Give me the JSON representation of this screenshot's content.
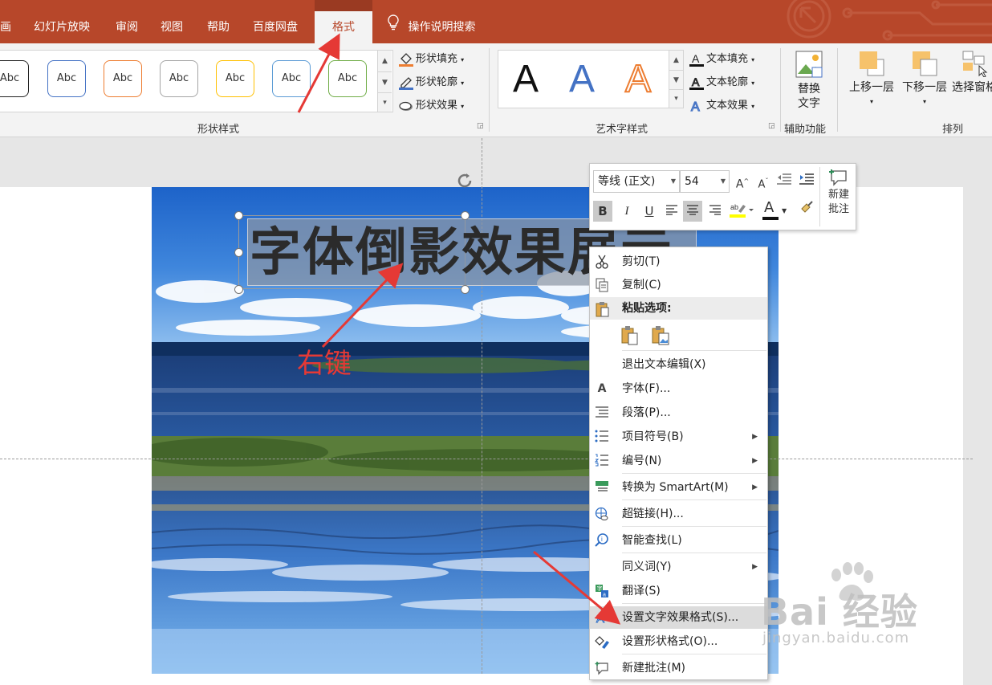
{
  "tabs": [
    {
      "label": "画"
    },
    {
      "label": "幻灯片放映"
    },
    {
      "label": "审阅"
    },
    {
      "label": "视图"
    },
    {
      "label": "帮助"
    },
    {
      "label": "百度网盘"
    },
    {
      "label": "格式",
      "active": true
    }
  ],
  "tell_me": "操作说明搜索",
  "ribbon": {
    "shape_styles": {
      "preview_label": "Abc",
      "swatch_colors": [
        "#222222",
        "#4472c4",
        "#ed7d31",
        "#a5a5a5",
        "#ffc000",
        "#5b9bd5",
        "#70ad47"
      ],
      "fill": "形状填充",
      "outline": "形状轮廓",
      "effect": "形状效果",
      "group_label": "形状样式"
    },
    "wordart": {
      "letter": "A",
      "text_fill": "文本填充",
      "text_outline": "文本轮廓",
      "text_effect": "文本效果",
      "group_label": "艺术字样式"
    },
    "accessibility": {
      "alt_text_line1": "替换",
      "alt_text_line2": "文字",
      "group_label": "辅助功能"
    },
    "arrange": {
      "bring_forward": "上移一层",
      "send_backward": "下移一层",
      "selection_pane": "选择窗格",
      "group_label": "排列"
    }
  },
  "slide": {
    "title_text": "字体倒影效果展示",
    "annotation": "右键"
  },
  "mini_toolbar": {
    "font": "等线 (正文)",
    "size": "54",
    "bold": "B",
    "italic": "I",
    "underline": "U",
    "font_color_letter": "A",
    "new_comment_line1": "新建",
    "new_comment_line2": "批注"
  },
  "context_menu": {
    "items": [
      {
        "label": "剪切(T)",
        "icon": "scissors-icon"
      },
      {
        "label": "复制(C)",
        "icon": "copy-icon"
      },
      {
        "label": "粘贴选项:",
        "icon": "paste-icon"
      },
      {
        "label": "退出文本编辑(X)"
      },
      {
        "label": "字体(F)...",
        "icon": "font-icon"
      },
      {
        "label": "段落(P)...",
        "icon": "paragraph-icon"
      },
      {
        "label": "项目符号(B)",
        "icon": "bullets-icon"
      },
      {
        "label": "编号(N)",
        "icon": "numbering-icon"
      },
      {
        "label": "转换为 SmartArt(M)",
        "icon": "smartart-icon"
      },
      {
        "label": "超链接(H)...",
        "icon": "hyperlink-icon"
      },
      {
        "label": "智能查找(L)",
        "icon": "smart-lookup-icon"
      },
      {
        "label": "同义词(Y)"
      },
      {
        "label": "翻译(S)",
        "icon": "translate-icon"
      },
      {
        "label": "设置文字效果格式(S)...",
        "icon": "text-effects-icon"
      },
      {
        "label": "设置形状格式(O)...",
        "icon": "format-shape-icon"
      },
      {
        "label": "新建批注(M)",
        "icon": "new-comment-icon"
      }
    ]
  },
  "watermark": {
    "brand": "Bai 经验",
    "url": "jingyan.baidu.com"
  },
  "colors": {
    "accent": "#b7472a",
    "annotation_red": "#e53935"
  }
}
